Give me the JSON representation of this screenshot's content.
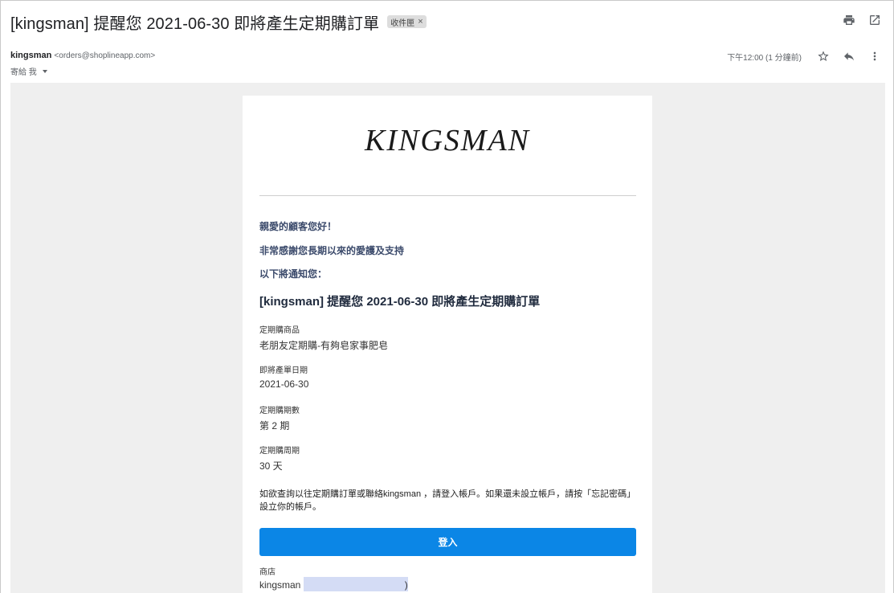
{
  "subject": "[kingsman] 提醒您 2021-06-30 即將產生定期購訂單",
  "label_chip": "收件匣",
  "label_chip_close": "×",
  "sender": {
    "name": "kingsman",
    "email": "<orders@shoplineapp.com>",
    "to": "寄給 我"
  },
  "timestamp": "下午12:00 (1 分鐘前)",
  "email": {
    "brand": "KINGSMAN",
    "greeting": "親愛的顧客您好！",
    "thanks": "非常感謝您長期以來的愛護及支持",
    "intro": "以下將通知您：",
    "heading": "[kingsman] 提醒您 2021-06-30 即將產生定期購訂單",
    "fields": [
      {
        "label": "定期購商品",
        "value": "老朋友定期購-有夠皂家事肥皂"
      },
      {
        "label": "即將產單日期",
        "value": "2021-06-30"
      },
      {
        "label": "定期購期數",
        "value": "第 2 期"
      },
      {
        "label": "定期購周期",
        "value": "30 天"
      }
    ],
    "notice": "如欲查詢以往定期購訂單或聯絡kingsman ，請登入帳戶。如果還未設立帳戶，請按「忘記密碼」設立你的帳戶。",
    "login_label": "登入",
    "shop_label": "商店",
    "shop_value_prefix": "kingsman (",
    "shop_value_suffix": ")"
  },
  "icons": [
    "print-icon",
    "open-in-new-window-icon",
    "star-icon",
    "reply-icon",
    "more-vert-icon",
    "dropdown-caret-icon"
  ],
  "colors": {
    "login_button": "#0b86e6",
    "greeting_text": "#3b4a6b",
    "canvas_bg": "#efefef"
  }
}
